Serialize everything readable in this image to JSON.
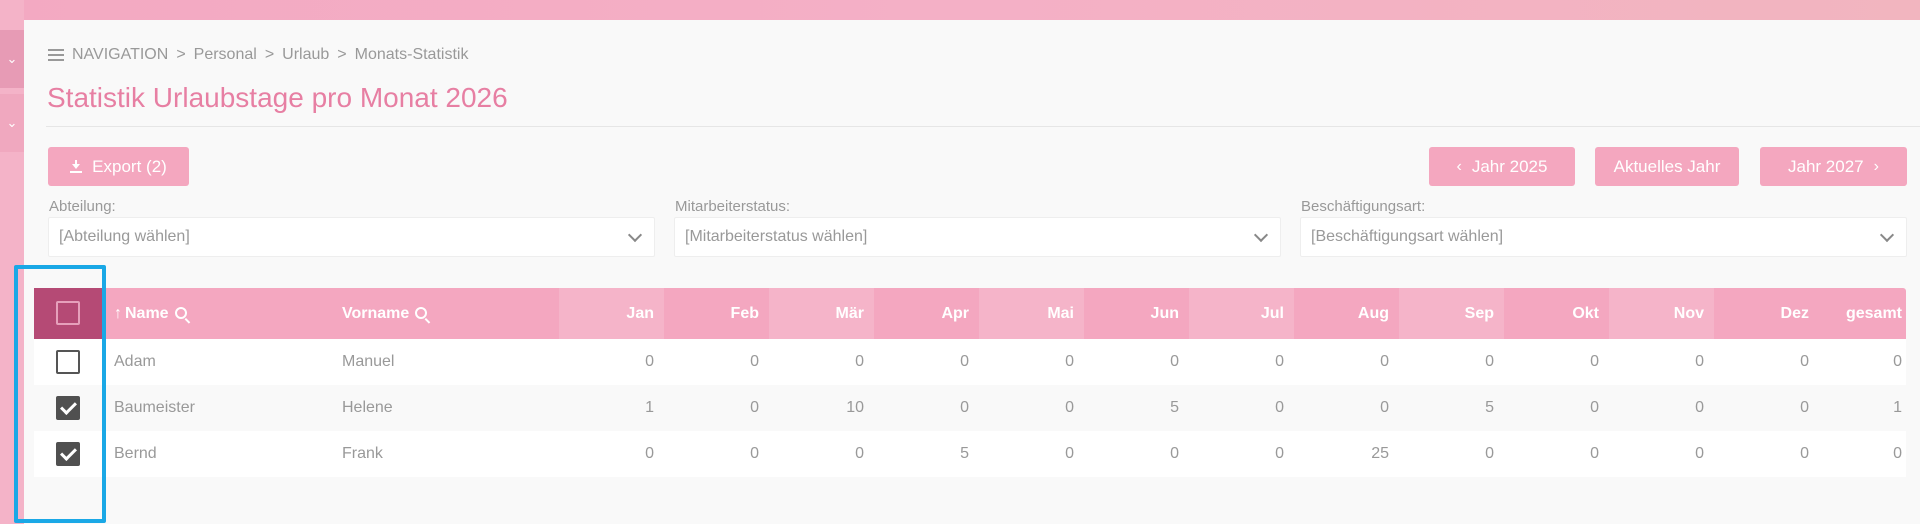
{
  "breadcrumb": {
    "items": [
      "NAVIGATION",
      "Personal",
      "Urlaub",
      "Monats-Statistik"
    ],
    "separator": ">"
  },
  "page": {
    "title": "Statistik Urlaubstage pro Monat 2026"
  },
  "toolbar": {
    "export_label": "Export (2)",
    "prev_year_label": "Jahr 2025",
    "current_year_label": "Aktuelles Jahr",
    "next_year_label": "Jahr 2027"
  },
  "filters": {
    "department": {
      "label": "Abteilung:",
      "value": "[Abteilung wählen]"
    },
    "employee_status": {
      "label": "Mitarbeiterstatus:",
      "value": "[Mitarbeiterstatus wählen]"
    },
    "employment_type": {
      "label": "Beschäftigungsart:",
      "value": "[Beschäftigungsart wählen]"
    }
  },
  "table": {
    "columns": {
      "name": "Name",
      "firstname": "Vorname",
      "months": [
        "Jan",
        "Feb",
        "Mär",
        "Apr",
        "Mai",
        "Jun",
        "Jul",
        "Aug",
        "Sep",
        "Okt",
        "Nov",
        "Dez"
      ],
      "total": "gesamt"
    },
    "rows": [
      {
        "checked": false,
        "name": "Adam",
        "firstname": "Manuel",
        "values": [
          "0",
          "0",
          "0",
          "0",
          "0",
          "0",
          "0",
          "0",
          "0",
          "0",
          "0",
          "0"
        ],
        "total": "0"
      },
      {
        "checked": true,
        "name": "Baumeister",
        "firstname": "Helene",
        "values": [
          "1",
          "0",
          "10",
          "0",
          "0",
          "5",
          "0",
          "0",
          "5",
          "0",
          "0",
          "0"
        ],
        "total": "1"
      },
      {
        "checked": true,
        "name": "Bernd",
        "firstname": "Frank",
        "values": [
          "0",
          "0",
          "0",
          "5",
          "0",
          "0",
          "0",
          "25",
          "0",
          "0",
          "0",
          "0"
        ],
        "total": "0"
      }
    ]
  },
  "colors": {
    "accent": "#f4a7bf",
    "title": "#e77fa3",
    "header_checkbox_cell": "#b54a75",
    "highlight": "#1aa8e6"
  }
}
